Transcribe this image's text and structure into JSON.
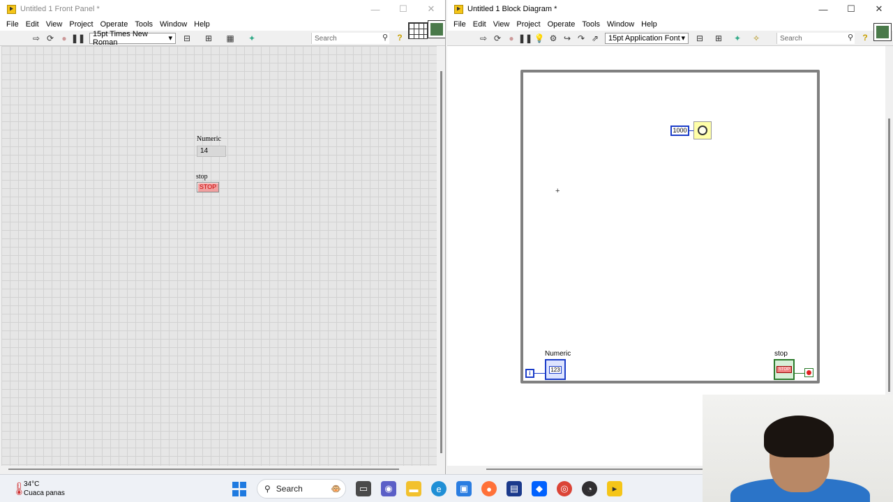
{
  "front_panel": {
    "title": "Untitled 1 Front Panel *",
    "menu": [
      "File",
      "Edit",
      "View",
      "Project",
      "Operate",
      "Tools",
      "Window",
      "Help"
    ],
    "font": "15pt Times New Roman",
    "search_placeholder": "Search",
    "numeric_label": "Numeric",
    "numeric_value": "14",
    "stop_label": "stop",
    "stop_button_text": "STOP"
  },
  "block_diagram": {
    "title": "Untitled 1 Block Diagram *",
    "menu": [
      "File",
      "Edit",
      "View",
      "Project",
      "Operate",
      "Tools",
      "Window",
      "Help"
    ],
    "font": "15pt Application Font",
    "search_placeholder": "Search",
    "wait_constant": "1000",
    "numeric_label": "Numeric",
    "numeric_terminal_text": "123",
    "iteration_terminal": "i",
    "stop_label": "stop",
    "stop_terminal_text": "STOP"
  },
  "window_controls": {
    "minimize": "—",
    "maximize": "☐",
    "close": "✕"
  },
  "taskbar": {
    "temperature": "34°C",
    "weather": "Cuaca panas",
    "search_label": "Search"
  }
}
